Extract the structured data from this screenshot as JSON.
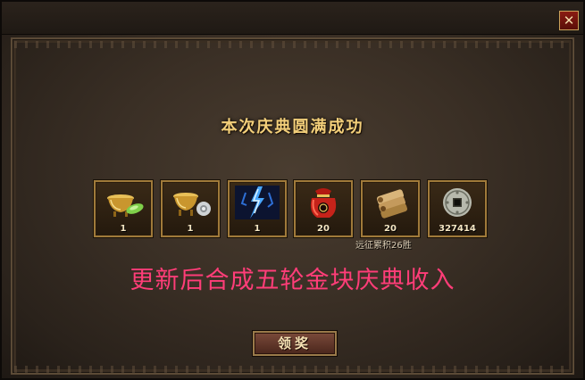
{
  "window": {
    "close_label": "✕"
  },
  "title": "本次庆典圆满成功",
  "rewards": [
    {
      "icon": "gold-cauldron-with-jade-icon",
      "count": "1"
    },
    {
      "icon": "gold-cauldron-with-silver-icon",
      "count": "1"
    },
    {
      "icon": "blue-lightning-crystal-icon",
      "count": "1"
    },
    {
      "icon": "red-lucky-bag-icon",
      "count": "20"
    },
    {
      "icon": "scroll-bundle-icon",
      "count": "20"
    },
    {
      "icon": "copper-coin-icon",
      "count": "327414"
    }
  ],
  "reward_note": "远征累积26胜",
  "announcement": "更新后合成五轮金块庆典收入",
  "claim_button": "领奖",
  "colors": {
    "title_gold": "#f3cf7a",
    "announcement_pink": "#ff3d78",
    "slot_border": "#a07a3a",
    "close_red": "#8a1c12"
  }
}
